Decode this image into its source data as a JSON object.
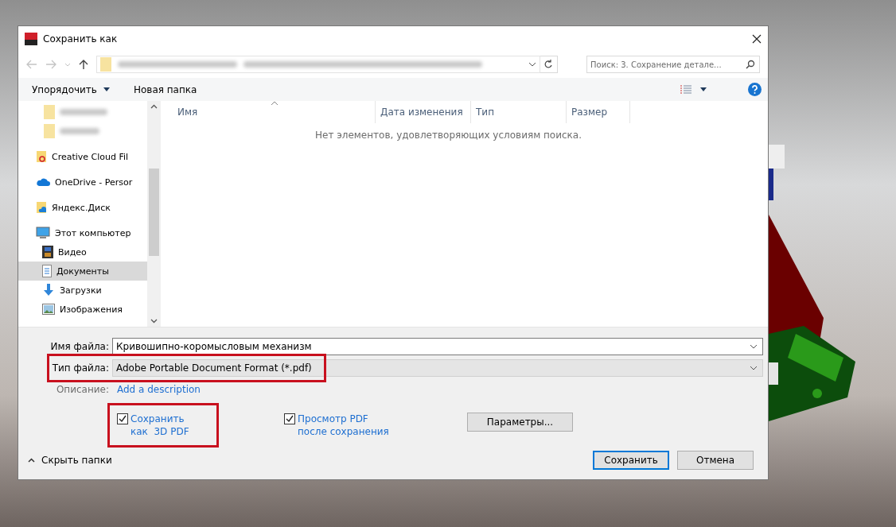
{
  "window": {
    "title": "Сохранить как"
  },
  "search": {
    "placeholder": "Поиск: 3. Сохранение детале..."
  },
  "toolbar": {
    "organize": "Упорядочить",
    "new_folder": "Новая папка"
  },
  "sidebar": {
    "items": [
      {
        "label": "Creative Cloud Fil",
        "kind": "creative",
        "selected": false
      },
      {
        "label": "OneDrive - Persor",
        "kind": "cloud",
        "selected": false
      },
      {
        "label": "Яндекс.Диск",
        "kind": "yandex",
        "selected": false
      },
      {
        "label": "Этот компьютер",
        "kind": "computer",
        "selected": false,
        "children": [
          {
            "label": "Видео",
            "kind": "video",
            "selected": false
          },
          {
            "label": "Документы",
            "kind": "documents",
            "selected": true
          },
          {
            "label": "Загрузки",
            "kind": "downloads",
            "selected": false
          },
          {
            "label": "Изображения",
            "kind": "images",
            "selected": false
          }
        ]
      }
    ]
  },
  "columns": [
    "Имя",
    "Дата изменения",
    "Тип",
    "Размер"
  ],
  "empty_message": "Нет элементов, удовлетворяющих условиям поиска.",
  "form": {
    "filename_label": "Имя файла:",
    "filename": "Кривошипно-коромысловым механизм",
    "filetype_label": "Тип файла:",
    "filetype": "Adobe Portable Document Format (*.pdf)",
    "filetype_highlighted": true,
    "description_label": "Описание:",
    "description_link": "Add a description"
  },
  "checkboxes": [
    {
      "label": "Сохранить как  3D PDF",
      "checked": true,
      "highlighted": true
    },
    {
      "label": "Просмотр PDF после сохранения",
      "checked": true,
      "highlighted": false
    }
  ],
  "options_button": "Параметры...",
  "hide_folders": "Скрыть папки",
  "buttons": [
    {
      "label": "Сохранить",
      "default": true
    },
    {
      "label": "Отмена",
      "default": false
    }
  ]
}
